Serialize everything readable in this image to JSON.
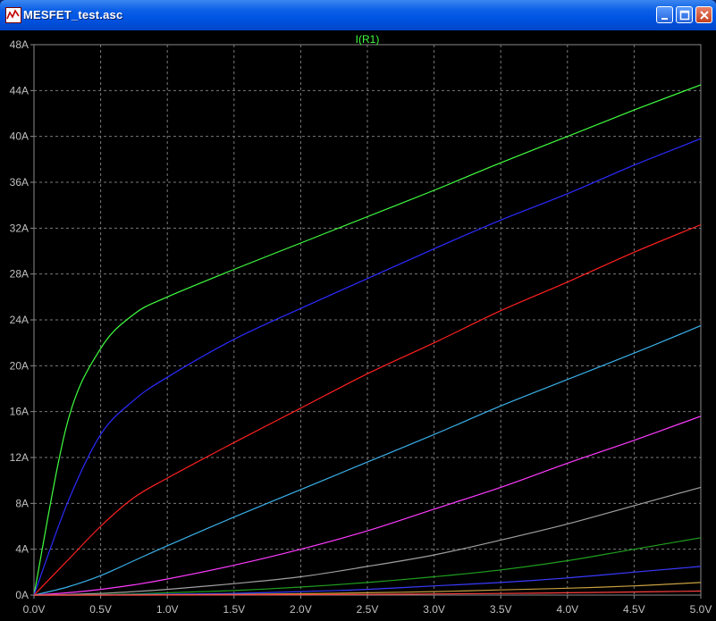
{
  "window": {
    "title": "MESFET_test.asc"
  },
  "titlebar_buttons": {
    "minimize": "minimize-icon",
    "maximize": "maximize-icon",
    "close": "close-icon"
  },
  "colors": {
    "titlebar": "#0054e3",
    "background": "#000000",
    "grid": "#7a7a7a",
    "axis_text": "#c0c0c0",
    "title_text": "#40ff40"
  },
  "chart_data": {
    "type": "line",
    "title": "I(R1)",
    "xlabel": "",
    "ylabel": "",
    "xlim": [
      0,
      5
    ],
    "ylim": [
      0,
      48
    ],
    "grid": true,
    "x_ticks": [
      "0.0V",
      "0.5V",
      "1.0V",
      "1.5V",
      "2.0V",
      "2.5V",
      "3.0V",
      "3.5V",
      "4.0V",
      "4.5V",
      "5.0V"
    ],
    "y_ticks": [
      "0A",
      "4A",
      "8A",
      "12A",
      "16A",
      "20A",
      "24A",
      "28A",
      "32A",
      "36A",
      "40A",
      "44A",
      "48A"
    ],
    "x": [
      0,
      0.25,
      0.5,
      0.75,
      1.0,
      1.5,
      2.0,
      2.5,
      3.0,
      3.5,
      4.0,
      4.5,
      5.0
    ],
    "series": [
      {
        "color": "#40ff40",
        "values": [
          0,
          15,
          21.5,
          24.5,
          26,
          28.4,
          30.7,
          33,
          35.3,
          37.7,
          40,
          42.3,
          44.5
        ]
      },
      {
        "color": "#2b2bff",
        "values": [
          0,
          8,
          14,
          17,
          19,
          22.3,
          25,
          27.6,
          30.2,
          32.7,
          35,
          37.5,
          39.8
        ]
      },
      {
        "color": "#ff2020",
        "values": [
          0,
          3,
          6,
          8.5,
          10.2,
          13.3,
          16.3,
          19.3,
          22,
          24.8,
          27.3,
          29.9,
          32.3
        ]
      },
      {
        "color": "#3ab0e8",
        "values": [
          0,
          0.7,
          1.7,
          3,
          4.3,
          6.8,
          9.2,
          11.6,
          14,
          16.5,
          18.8,
          21.1,
          23.5
        ]
      },
      {
        "color": "#ff3aff",
        "values": [
          0,
          0.2,
          0.5,
          0.9,
          1.4,
          2.6,
          4,
          5.6,
          7.5,
          9.4,
          11.5,
          13.5,
          15.6
        ]
      },
      {
        "color": "#a0a0a0",
        "values": [
          0,
          0.05,
          0.15,
          0.3,
          0.5,
          1,
          1.6,
          2.5,
          3.5,
          4.8,
          6.2,
          7.8,
          9.4
        ]
      },
      {
        "color": "#20a020",
        "values": [
          0,
          0.02,
          0.05,
          0.1,
          0.2,
          0.4,
          0.7,
          1.1,
          1.6,
          2.2,
          3,
          4,
          5
        ]
      },
      {
        "color": "#3a3aff",
        "values": [
          0,
          0,
          0.02,
          0.05,
          0.08,
          0.15,
          0.3,
          0.5,
          0.8,
          1.1,
          1.5,
          2,
          2.5
        ]
      },
      {
        "color": "#c8a040",
        "values": [
          0,
          0,
          0,
          0.02,
          0.03,
          0.06,
          0.12,
          0.2,
          0.3,
          0.45,
          0.6,
          0.8,
          1.1
        ]
      },
      {
        "color": "#ff4040",
        "values": [
          0,
          0,
          0,
          0,
          0.01,
          0.02,
          0.04,
          0.06,
          0.1,
          0.14,
          0.2,
          0.27,
          0.35
        ]
      }
    ]
  }
}
